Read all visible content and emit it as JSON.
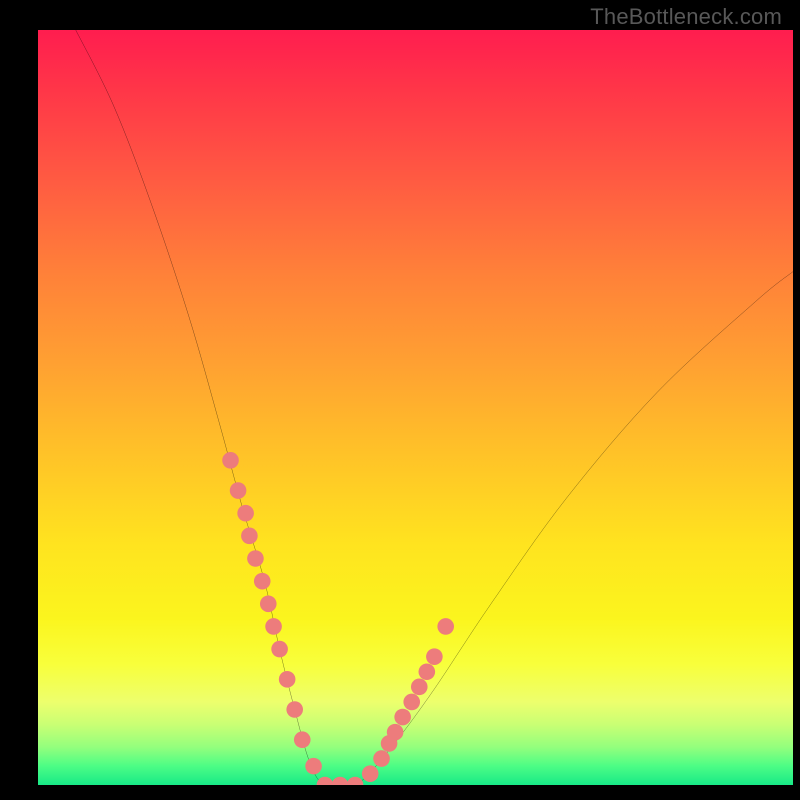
{
  "watermark": "TheBottleneck.com",
  "chart_data": {
    "type": "line",
    "title": "",
    "xlabel": "",
    "ylabel": "",
    "xlim": [
      0,
      100
    ],
    "ylim": [
      0,
      100
    ],
    "series": [
      {
        "name": "curve",
        "x": [
          5,
          10,
          15,
          20,
          24,
          27,
          30,
          32,
          34,
          36,
          38,
          42,
          46,
          52,
          60,
          70,
          82,
          95,
          100
        ],
        "y": [
          100,
          90,
          77,
          62,
          48,
          37,
          27,
          18,
          10,
          3,
          0,
          0,
          4,
          12,
          24,
          38,
          52,
          64,
          68
        ]
      }
    ],
    "markers": {
      "name": "highlighted-points",
      "color": "#ed7c7c",
      "x": [
        25.5,
        26.5,
        27.5,
        28,
        28.8,
        29.7,
        30.5,
        31.2,
        32,
        33,
        34,
        35,
        36.5,
        38,
        40,
        42,
        44,
        45.5,
        46.5,
        47.3,
        48.3,
        49.5,
        50.5,
        51.5,
        52.5,
        54
      ],
      "y": [
        43,
        39,
        36,
        33,
        30,
        27,
        24,
        21,
        18,
        14,
        10,
        6,
        2.5,
        0,
        0,
        0,
        1.5,
        3.5,
        5.5,
        7,
        9,
        11,
        13,
        15,
        17,
        21
      ]
    },
    "gradient_stops": [
      {
        "pos": 0,
        "color": "#ff1d4f"
      },
      {
        "pos": 50,
        "color": "#ffc228"
      },
      {
        "pos": 82,
        "color": "#f8ff3b"
      },
      {
        "pos": 100,
        "color": "#18e987"
      }
    ]
  }
}
